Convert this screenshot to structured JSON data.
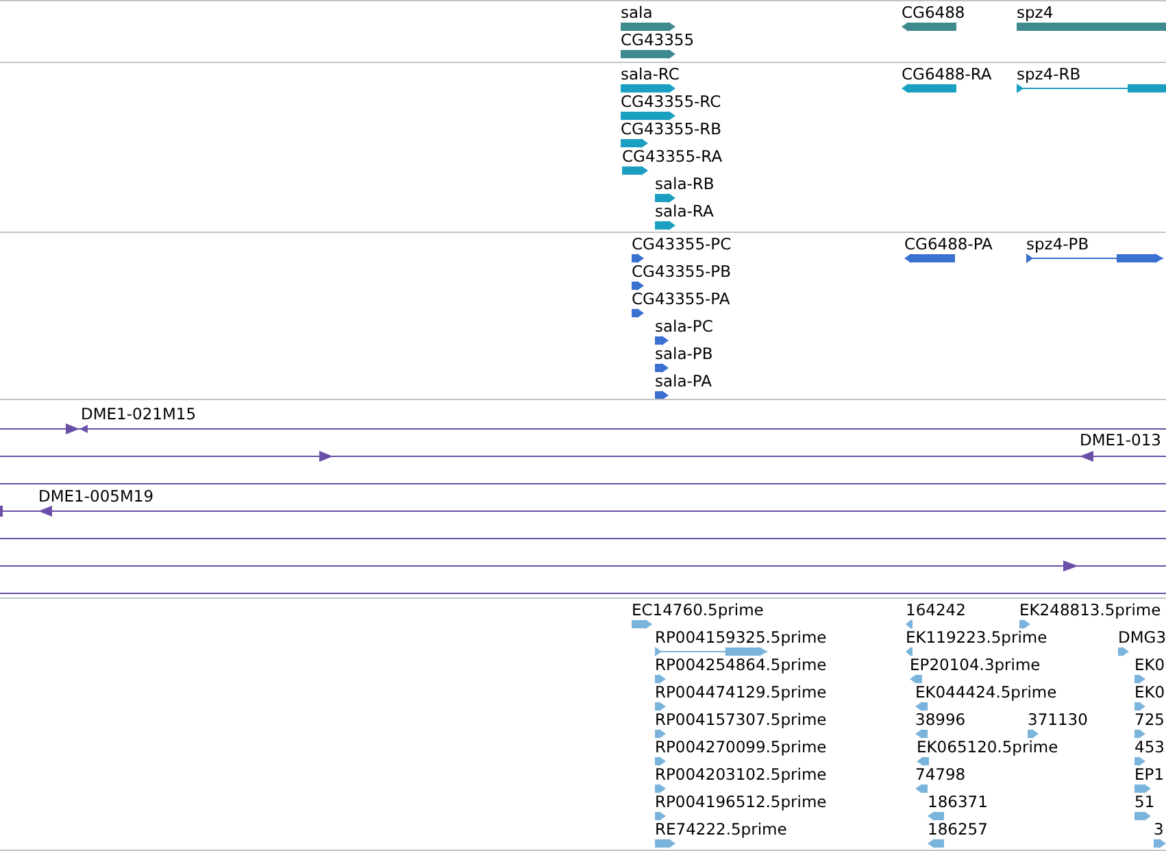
{
  "tracks": [
    {
      "kind": "gene",
      "color": "#3f8a8f",
      "features": [
        {
          "label": "sala",
          "reverse": false
        },
        {
          "label": "CG43355",
          "reverse": false
        },
        {
          "label": "CG6488",
          "reverse": true
        },
        {
          "label": "spz4"
        }
      ]
    },
    {
      "kind": "gene",
      "color": "#1a9fc0",
      "features": [
        {
          "label": "sala-RC",
          "reverse": false
        },
        {
          "label": "CG43355-RC",
          "reverse": false
        },
        {
          "label": "CG43355-RB",
          "reverse": false
        },
        {
          "label": "CG43355-RA",
          "reverse": false
        },
        {
          "label": "sala-RB",
          "reverse": false
        },
        {
          "label": "sala-RA",
          "reverse": false
        },
        {
          "label": "CG6488-RA",
          "reverse": true
        },
        {
          "label": "spz4-RB",
          "reverse": false
        }
      ]
    },
    {
      "kind": "gene",
      "color": "#3a70d0",
      "features": [
        {
          "label": "CG43355-PC",
          "reverse": false
        },
        {
          "label": "CG43355-PB",
          "reverse": false
        },
        {
          "label": "CG43355-PA",
          "reverse": false
        },
        {
          "label": "sala-PC",
          "reverse": false
        },
        {
          "label": "sala-PB",
          "reverse": false
        },
        {
          "label": "sala-PA",
          "reverse": false
        },
        {
          "label": "CG6488-PA",
          "reverse": true
        },
        {
          "label": "spz4-PB",
          "reverse": false
        }
      ]
    },
    {
      "kind": "clone",
      "color": "#6a4fa8",
      "features": [
        {
          "label": "DME1-021M15"
        },
        {
          "label": "DME1-013"
        },
        {
          "label": "DME1-005M19"
        }
      ]
    },
    {
      "kind": "gene",
      "color": "#7ab4dc",
      "features": [
        {
          "label": "EC14760.5prime",
          "reverse": false
        },
        {
          "label": "RP004159325.5prime",
          "reverse": false
        },
        {
          "label": "RP004254864.5prime",
          "reverse": false
        },
        {
          "label": "RP004474129.5prime",
          "reverse": false
        },
        {
          "label": "RP004157307.5prime",
          "reverse": false
        },
        {
          "label": "RP004270099.5prime",
          "reverse": false
        },
        {
          "label": "RP004203102.5prime",
          "reverse": false
        },
        {
          "label": "RP004196512.5prime",
          "reverse": false
        },
        {
          "label": "RE74222.5prime",
          "reverse": false
        },
        {
          "label": "164242",
          "reverse": true
        },
        {
          "label": "EK119223.5prime",
          "reverse": true
        },
        {
          "label": "EP20104.3prime",
          "reverse": true
        },
        {
          "label": "EK044424.5prime",
          "reverse": true
        },
        {
          "label": "38996",
          "reverse": true
        },
        {
          "label": "EK065120.5prime",
          "reverse": true
        },
        {
          "label": "74798",
          "reverse": true
        },
        {
          "label": "186371",
          "reverse": true
        },
        {
          "label": "186257",
          "reverse": true
        },
        {
          "label": "EK248813.5prime",
          "reverse": false
        },
        {
          "label": "371130",
          "reverse": false
        },
        {
          "label": "DMG3",
          "reverse": false
        },
        {
          "label": "EK0",
          "reverse": false
        },
        {
          "label": "EK0",
          "reverse": false
        },
        {
          "label": "725",
          "reverse": false
        },
        {
          "label": "453",
          "reverse": false
        },
        {
          "label": "EP1",
          "reverse": false
        },
        {
          "label": "51",
          "reverse": false
        },
        {
          "label": "3",
          "reverse": false
        }
      ]
    }
  ]
}
